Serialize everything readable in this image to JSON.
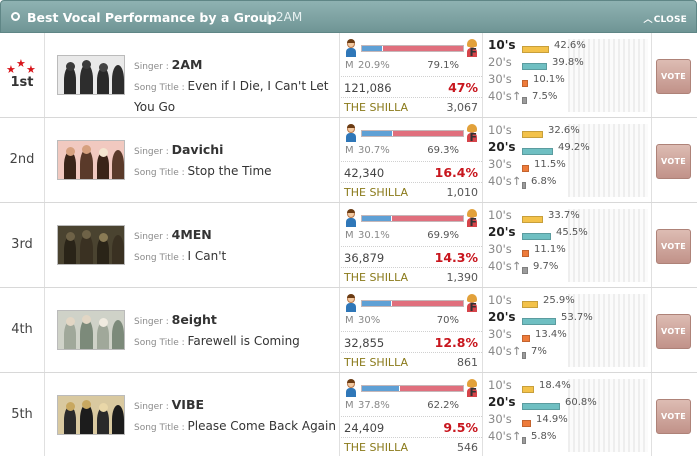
{
  "header": {
    "title": "Best Vocal Performance by a Group",
    "separator": "|",
    "subtitle": "2AM",
    "close_label": "CLOSE",
    "close_chevron": "︿"
  },
  "labels": {
    "singer": "Singer : ",
    "song_title": "Song Title : ",
    "male": "M",
    "female": "F",
    "vote": "VOTE",
    "stars": "★★★"
  },
  "colors": {
    "header": "#7ba1a1",
    "share": "#c8161e",
    "male_bar": "#5fa0d5",
    "female_bar": "#e06f7d",
    "age_10s": "#f3c24a",
    "age_20s": "#6fbfc2",
    "age_30s": "#ee7b3a",
    "age_40s": "#9b9b9b",
    "vote_button": "#cfa79e"
  },
  "entries": [
    {
      "rank": "1st",
      "singer": "2AM",
      "song": "Even if I Die, I Can't Let You Go",
      "male_pct": "20.9%",
      "female_pct": "79.1%",
      "male_share": 0.209,
      "votes": "121,086",
      "share": "47%",
      "venue": "THE SHILLA",
      "venue_count": "3,067",
      "ages": [
        {
          "label": "10's",
          "pct": "42.6%",
          "value": 42.6
        },
        {
          "label": "20's",
          "pct": "39.8%",
          "value": 39.8
        },
        {
          "label": "30's",
          "pct": "10.1%",
          "value": 10.1
        },
        {
          "label": "40's↑",
          "pct": "7.5%",
          "value": 7.5
        }
      ],
      "top_age": 0
    },
    {
      "rank": "2nd",
      "singer": "Davichi",
      "song": "Stop the Time",
      "male_pct": "30.7%",
      "female_pct": "69.3%",
      "male_share": 0.307,
      "votes": "42,340",
      "share": "16.4%",
      "venue": "THE SHILLA",
      "venue_count": "1,010",
      "ages": [
        {
          "label": "10's",
          "pct": "32.6%",
          "value": 32.6
        },
        {
          "label": "20's",
          "pct": "49.2%",
          "value": 49.2
        },
        {
          "label": "30's",
          "pct": "11.5%",
          "value": 11.5
        },
        {
          "label": "40's↑",
          "pct": "6.8%",
          "value": 6.8
        }
      ],
      "top_age": 1
    },
    {
      "rank": "3rd",
      "singer": "4MEN",
      "song": "I Can't",
      "male_pct": "30.1%",
      "female_pct": "69.9%",
      "male_share": 0.301,
      "votes": "36,879",
      "share": "14.3%",
      "venue": "THE SHILLA",
      "venue_count": "1,390",
      "ages": [
        {
          "label": "10's",
          "pct": "33.7%",
          "value": 33.7
        },
        {
          "label": "20's",
          "pct": "45.5%",
          "value": 45.5
        },
        {
          "label": "30's",
          "pct": "11.1%",
          "value": 11.1
        },
        {
          "label": "40's↑",
          "pct": "9.7%",
          "value": 9.7
        }
      ],
      "top_age": 1
    },
    {
      "rank": "4th",
      "singer": "8eight",
      "song": "Farewell is Coming",
      "male_pct": "30%",
      "female_pct": "70%",
      "male_share": 0.3,
      "votes": "32,855",
      "share": "12.8%",
      "venue": "THE SHILLA",
      "venue_count": "861",
      "ages": [
        {
          "label": "10's",
          "pct": "25.9%",
          "value": 25.9
        },
        {
          "label": "20's",
          "pct": "53.7%",
          "value": 53.7
        },
        {
          "label": "30's",
          "pct": "13.4%",
          "value": 13.4
        },
        {
          "label": "40's↑",
          "pct": "7%",
          "value": 7
        }
      ],
      "top_age": 1
    },
    {
      "rank": "5th",
      "singer": "VIBE",
      "song": "Please Come Back Again",
      "male_pct": "37.8%",
      "female_pct": "62.2%",
      "male_share": 0.378,
      "votes": "24,409",
      "share": "9.5%",
      "venue": "THE SHILLA",
      "venue_count": "546",
      "ages": [
        {
          "label": "10's",
          "pct": "18.4%",
          "value": 18.4
        },
        {
          "label": "20's",
          "pct": "60.8%",
          "value": 60.8
        },
        {
          "label": "30's",
          "pct": "14.9%",
          "value": 14.9
        },
        {
          "label": "40's↑",
          "pct": "5.8%",
          "value": 5.8
        }
      ],
      "top_age": 1
    }
  ]
}
